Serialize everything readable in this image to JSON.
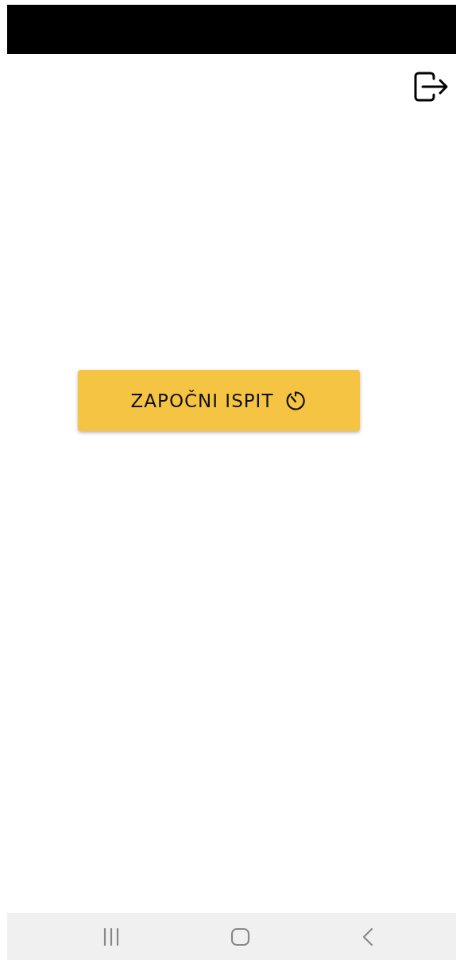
{
  "start_button": {
    "label": "ZAPOČNI ISPIT"
  }
}
